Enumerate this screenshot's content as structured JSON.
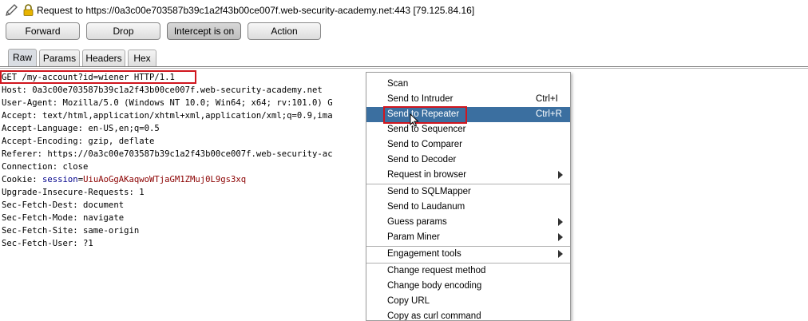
{
  "header": {
    "request_text": "Request to https://0a3c00e703587b39c1a2f43b00ce007f.web-security-academy.net:443  [79.125.84.16]",
    "icons": [
      "pencil-icon",
      "lock-icon"
    ]
  },
  "toolbar": {
    "forward": "Forward",
    "drop": "Drop",
    "intercept": "Intercept is on",
    "action": "Action"
  },
  "tabs": [
    "Raw",
    "Params",
    "Headers",
    "Hex"
  ],
  "request": {
    "lines": [
      "GET /my-account?id=wiener HTTP/1.1",
      "Host: 0a3c00e703587b39c1a2f43b00ce007f.web-security-academy.net",
      "User-Agent: Mozilla/5.0 (Windows NT 10.0; Win64; x64; rv:101.0) G",
      "Accept: text/html,application/xhtml+xml,application/xml;q=0.9,ima",
      "Accept-Language: en-US,en;q=0.5",
      "Accept-Encoding: gzip, deflate",
      "Referer: https://0a3c00e703587b39c1a2f43b00ce007f.web-security-ac",
      "Connection: close"
    ],
    "cookie_prefix": "Cookie: ",
    "cookie_name": "session",
    "cookie_eq": "=",
    "cookie_value": "UiuAoGgAKaqwoWTjaGM1ZMuj0L9gs3xq",
    "lines_after": [
      "Upgrade-Insecure-Requests: 1",
      "Sec-Fetch-Dest: document",
      "Sec-Fetch-Mode: navigate",
      "Sec-Fetch-Site: same-origin",
      "Sec-Fetch-User: ?1"
    ]
  },
  "menu": {
    "items": [
      {
        "label": "Scan"
      },
      {
        "label": "Send to Intruder",
        "shortcut": "Ctrl+I"
      },
      {
        "label": "Send to Repeater",
        "shortcut": "Ctrl+R"
      },
      {
        "label": "Send to Sequencer"
      },
      {
        "label": "Send to Comparer"
      },
      {
        "label": "Send to Decoder"
      },
      {
        "label": "Request in browser"
      },
      {
        "label": "Send to SQLMapper"
      },
      {
        "label": "Send to Laudanum"
      },
      {
        "label": "Guess params"
      },
      {
        "label": "Param Miner"
      },
      {
        "label": "Engagement tools"
      },
      {
        "label": "Change request method"
      },
      {
        "label": "Change body encoding"
      },
      {
        "label": "Copy URL"
      },
      {
        "label": "Copy as curl command"
      }
    ]
  },
  "colors": {
    "menu_highlight": "#3b6fa0",
    "annotation_box": "#d0161e",
    "cookie_name": "#00008b",
    "cookie_value": "#8b0000"
  }
}
